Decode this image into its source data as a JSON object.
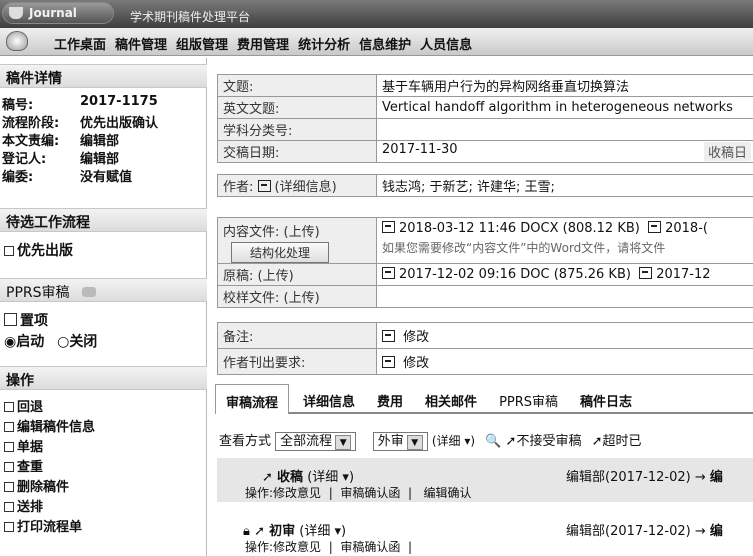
{
  "header": {
    "logo_text": "Journal",
    "subtitle": "学术期刊稿件处理平台"
  },
  "menu": [
    "工作桌面",
    "稿件管理",
    "组版管理",
    "费用管理",
    "统计分析",
    "信息维护",
    "人员信息"
  ],
  "sidebar": {
    "detail_title": "稿件详情",
    "fields": [
      {
        "k": "稿号:",
        "v": "2017-1175"
      },
      {
        "k": "流程阶段:",
        "v": "优先出版确认"
      },
      {
        "k": "本文责编:",
        "v": "编辑部"
      },
      {
        "k": "登记人:",
        "v": "编辑部"
      },
      {
        "k": "编委:",
        "v": "没有赋值"
      }
    ],
    "workflow_title": "待选工作流程",
    "workflow_item": "优先出版",
    "pprs_title": "PPRS审稿",
    "pprs_top": "置项",
    "pprs_on": "启动",
    "pprs_off": "关闭",
    "ops_title": "操作",
    "ops": [
      "回退",
      "编辑稿件信息",
      "单据",
      "查重",
      "删除稿件",
      "送排",
      "打印流程单"
    ]
  },
  "info": {
    "title_label": "文题:",
    "title_value": "基于车辆用户行为的异构网络垂直切换算法",
    "en_title_label": "英文文题:",
    "en_title_value": "Vertical handoff algorithm in heterogeneous networks",
    "subject_label": "学科分类号:",
    "date_label": "交稿日期:",
    "date_value": "2017-11-30",
    "received_label": "收稿日",
    "authors_label": "作者:",
    "authors_detail": "(详细信息)",
    "authors_value": "钱志鸿; 于新艺; 许建华; 王雪;"
  },
  "files": {
    "content_label": "内容文件: (上传)",
    "struct_button": "结构化处理",
    "content_file": "2018-03-12 11:46 DOCX (808.12 KB)",
    "content_file2": "2018-(",
    "content_note": "如果您需要修改“内容文件”中的Word文件，请将文件",
    "original_label": "原稿: (上传)",
    "original_file": "2017-12-02 09:16 DOC (875.26 KB)",
    "original_file2": "2017-12",
    "proof_label": "校样文件: (上传)",
    "remark_label": "备注:",
    "remark_value": "修改",
    "pub_label": "作者刊出要求:",
    "pub_value": "修改"
  },
  "tabs": [
    "审稿流程",
    "详细信息",
    "费用",
    "相关邮件",
    "PPRS审稿",
    "稿件日志"
  ],
  "filter": {
    "view_label": "查看方式",
    "view_value": "全部流程",
    "review_value": "外审",
    "detail": "(详细",
    "no_accept": "不接受审稿",
    "timeout": "超时已"
  },
  "flow": [
    {
      "title": "收稿",
      "detail": "(详细",
      "right": "编辑部(2017-12-02) →",
      "right2": "编",
      "ops_prefix": "操作:",
      "ops": [
        "修改意见",
        "审稿确认函",
        "编辑确认"
      ]
    },
    {
      "title": "初审",
      "detail": "(详细",
      "right": "编辑部(2017-12-02) →",
      "right2": "编",
      "ops_prefix": "操作:",
      "ops": [
        "修改意见",
        "审稿确认函"
      ]
    }
  ]
}
